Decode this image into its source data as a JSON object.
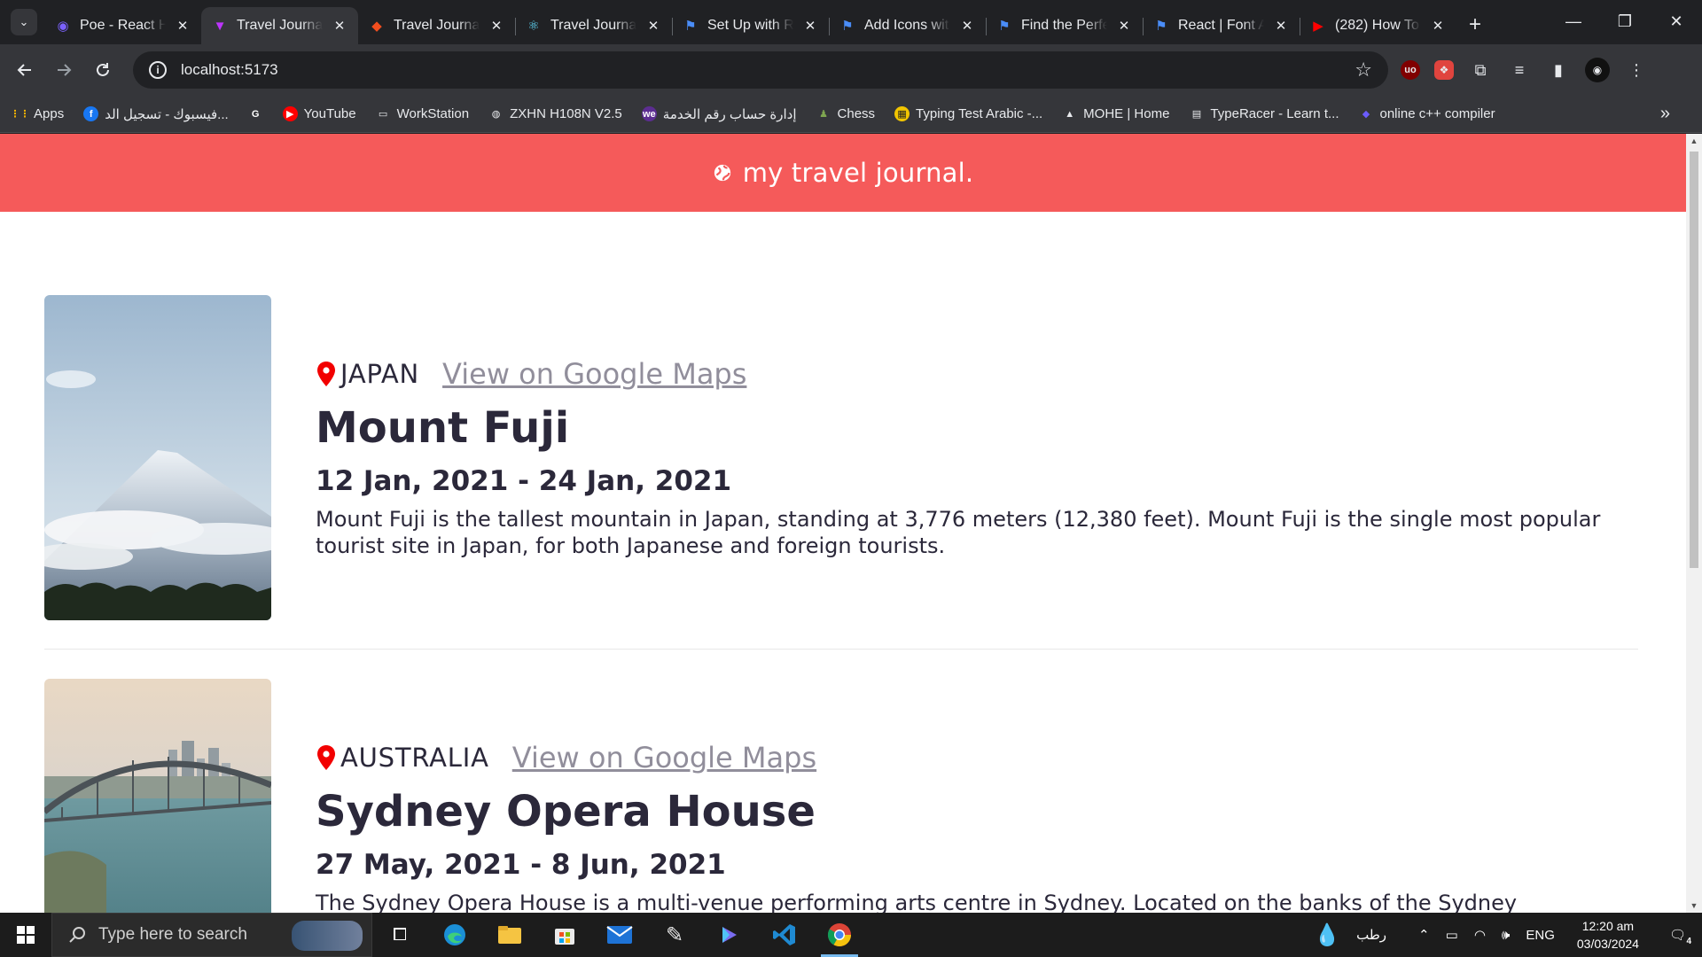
{
  "browser": {
    "tabs": [
      {
        "title": "Poe - React H",
        "icon": "poe-icon",
        "color": "#7b61ff",
        "active": false
      },
      {
        "title": "Travel Journal",
        "icon": "vite-icon",
        "color": "#bd34fe",
        "active": true
      },
      {
        "title": "Travel Journal",
        "icon": "figma-icon",
        "color": "#f24e1e",
        "active": false
      },
      {
        "title": "Travel Journal",
        "icon": "react-icon",
        "color": "#61dafb",
        "active": false
      },
      {
        "title": "Set Up with R",
        "icon": "flag-icon",
        "color": "#4a8df8",
        "active": false
      },
      {
        "title": "Add Icons wit",
        "icon": "flag-icon",
        "color": "#4a8df8",
        "active": false
      },
      {
        "title": "Find the Perfe",
        "icon": "flag-icon",
        "color": "#4a8df8",
        "active": false
      },
      {
        "title": "React | Font A",
        "icon": "flag-icon",
        "color": "#4a8df8",
        "active": false
      },
      {
        "title": "(282) How To",
        "icon": "youtube-icon",
        "color": "#ff0000",
        "active": false
      }
    ],
    "url": "localhost:5173",
    "bookmarks": [
      {
        "label": "Apps",
        "icon": "apps-grid-icon"
      },
      {
        "label": "فيسبوك - تسجيل الد...",
        "icon": "facebook-icon"
      },
      {
        "label": "",
        "icon": "google-icon"
      },
      {
        "label": "YouTube",
        "icon": "youtube-icon"
      },
      {
        "label": "WorkStation",
        "icon": "folder-icon"
      },
      {
        "label": "ZXHN H108N V2.5",
        "icon": "globe-icon"
      },
      {
        "label": "إدارة حساب رقم الخدمة",
        "icon": "we-icon"
      },
      {
        "label": "Chess",
        "icon": "chess-icon"
      },
      {
        "label": "Typing Test Arabic -...",
        "icon": "typing-icon"
      },
      {
        "label": "MOHE | Home",
        "icon": "mohe-icon"
      },
      {
        "label": "TypeRacer - Learn t...",
        "icon": "typeracer-icon"
      },
      {
        "label": "online c++ compiler",
        "icon": "cpp-icon"
      }
    ]
  },
  "site": {
    "header_title": "my travel journal.",
    "accent": "#f55a5a",
    "entries": [
      {
        "country": "JAPAN",
        "map_link": "View on Google Maps",
        "title": "Mount Fuji",
        "dates": "12 Jan, 2021 - 24 Jan, 2021",
        "description": "Mount Fuji is the tallest mountain in Japan, standing at 3,776 meters (12,380 feet). Mount Fuji is the single most popular tourist site in Japan, for both Japanese and foreign tourists."
      },
      {
        "country": "AUSTRALIA",
        "map_link": "View on Google Maps",
        "title": "Sydney Opera House",
        "dates": "27 May, 2021 - 8 Jun, 2021",
        "description": "The Sydney Opera House is a multi-venue performing arts centre in Sydney. Located on the banks of the Sydney Harbour, it is"
      }
    ]
  },
  "taskbar": {
    "search_placeholder": "Type here to search",
    "weather": "رطب",
    "language": "ENG",
    "time": "12:20 am",
    "date": "03/03/2024",
    "notifications": "4"
  }
}
